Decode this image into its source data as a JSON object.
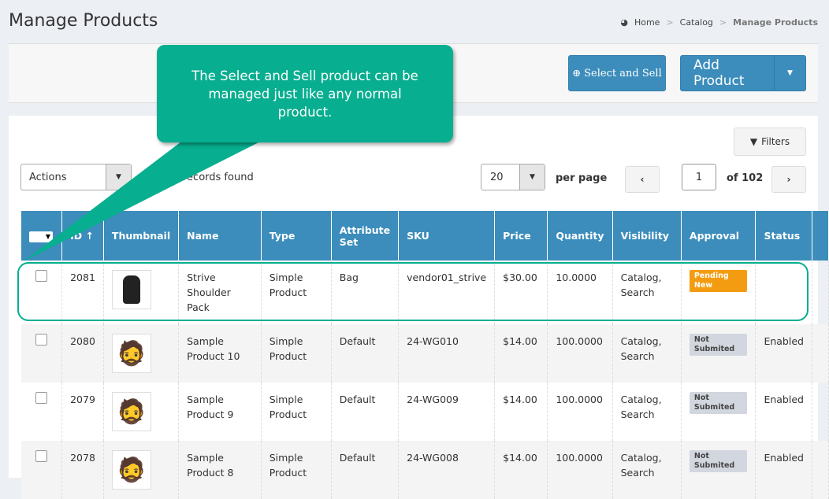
{
  "page": {
    "title": "Manage Products"
  },
  "breadcrumb": [
    "Home",
    "Catalog",
    "Manage Products"
  ],
  "toolbar": {
    "select_sell": "Select and Sell",
    "add_product": "Add Product"
  },
  "controls": {
    "actions": "Actions",
    "records": "records found",
    "per_page_value": "20",
    "per_page_label": "per page",
    "page": "1",
    "of_pages": "of 102",
    "filters": "Filters"
  },
  "callout": {
    "text": "The Select and Sell product can be managed just like any normal product.",
    "color": "#07ae8f"
  },
  "table": {
    "headers": [
      "ID",
      "Thumbnail",
      "Name",
      "Type",
      "Attribute Set",
      "SKU",
      "Price",
      "Quantity",
      "Visibility",
      "Approval",
      "Status"
    ],
    "rows": [
      {
        "id": "2081",
        "name": "Strive Shoulder Pack",
        "type": "Simple Product",
        "attr": "Bag",
        "sku": "vendor01_strive",
        "price": "$30.00",
        "qty": "10.0000",
        "visibility": "Catalog, Search",
        "approval": "Pending New",
        "status": ""
      },
      {
        "id": "2080",
        "name": "Sample Product 10",
        "type": "Simple Product",
        "attr": "Default",
        "sku": "24-WG010",
        "price": "$14.00",
        "qty": "100.0000",
        "visibility": "Catalog, Search",
        "approval": "Not Submited",
        "status": "Enabled"
      },
      {
        "id": "2079",
        "name": "Sample Product 9",
        "type": "Simple Product",
        "attr": "Default",
        "sku": "24-WG009",
        "price": "$14.00",
        "qty": "100.0000",
        "visibility": "Catalog, Search",
        "approval": "Not Submited",
        "status": "Enabled"
      },
      {
        "id": "2078",
        "name": "Sample Product 8",
        "type": "Simple Product",
        "attr": "Default",
        "sku": "24-WG008",
        "price": "$14.00",
        "qty": "100.0000",
        "visibility": "Catalog, Search",
        "approval": "Not Submited",
        "status": "Enabled"
      }
    ]
  },
  "colors": {
    "header": "#3c8dbc",
    "pending": "#f39c12",
    "not_submitted": "#d2d6de"
  }
}
